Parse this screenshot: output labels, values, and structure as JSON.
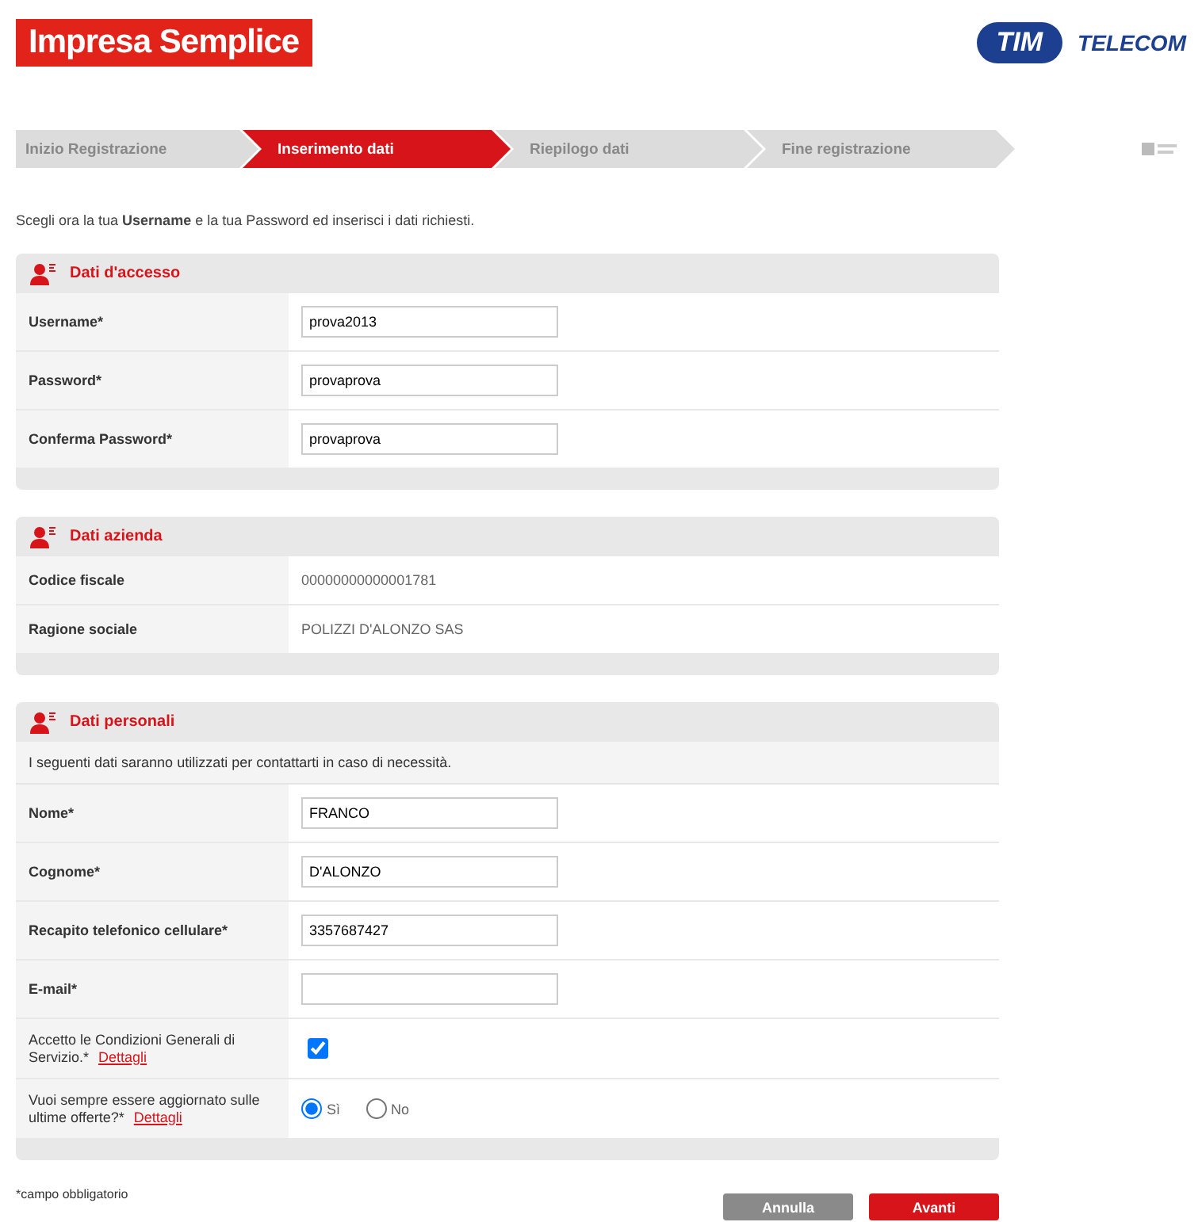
{
  "brand": {
    "title": "Impresa Semplice",
    "logos": [
      "TIM",
      "TELECOM"
    ]
  },
  "steps": [
    {
      "label": "Inizio Registrazione",
      "selected": false
    },
    {
      "label": "Inserimento dati",
      "selected": true
    },
    {
      "label": "Riepilogo dati",
      "selected": false
    },
    {
      "label": "Fine registrazione",
      "selected": false
    }
  ],
  "intro": "Scegli ora la tua **Username** e la tua Password ed inserisci i dati richiesti.",
  "sections": [
    {
      "title": "Dati d'accesso",
      "rows": [
        {
          "kind": "input",
          "label": "Username*",
          "value": "prova2013"
        },
        {
          "kind": "input",
          "label": "Password*",
          "value": "provaprova"
        },
        {
          "kind": "input",
          "label": "Conferma Password*",
          "value": "provaprova"
        }
      ]
    },
    {
      "title": "Dati azienda",
      "rows": [
        {
          "kind": "text",
          "label": "Codice fiscale",
          "value": "00000000000001781"
        },
        {
          "kind": "text",
          "label": "Ragione sociale",
          "value": "POLIZZI D'ALONZO SAS"
        }
      ]
    },
    {
      "title": "Dati personali",
      "description": "I seguenti dati saranno utilizzati per contattarti in caso di necessità.",
      "rows": [
        {
          "kind": "input",
          "label": "Nome*",
          "value": "FRANCO"
        },
        {
          "kind": "input",
          "label": "Cognome*",
          "value": "D'ALONZO"
        },
        {
          "kind": "input",
          "label": "Recapito telefonico cellulare*",
          "value": "3357687427"
        },
        {
          "kind": "input",
          "label": "E-mail*"
        },
        {
          "kind": "checkbox",
          "label": "Accetto le Condizioni Generali di Servizio.*",
          "link": "Dettagli",
          "checked": true
        },
        {
          "kind": "radio",
          "label": "Vuoi sempre essere aggiornato sulle ultime offerte?*",
          "link": "Dettagli",
          "options": [
            {
              "label": "Sì",
              "selected": true
            },
            {
              "label": "No",
              "selected": false
            }
          ]
        }
      ]
    }
  ],
  "footnote": "*campo obbligatorio",
  "buttons": [
    {
      "kind": "secondary",
      "label": "Annulla"
    },
    {
      "kind": "primary",
      "label": "Avanti"
    }
  ]
}
